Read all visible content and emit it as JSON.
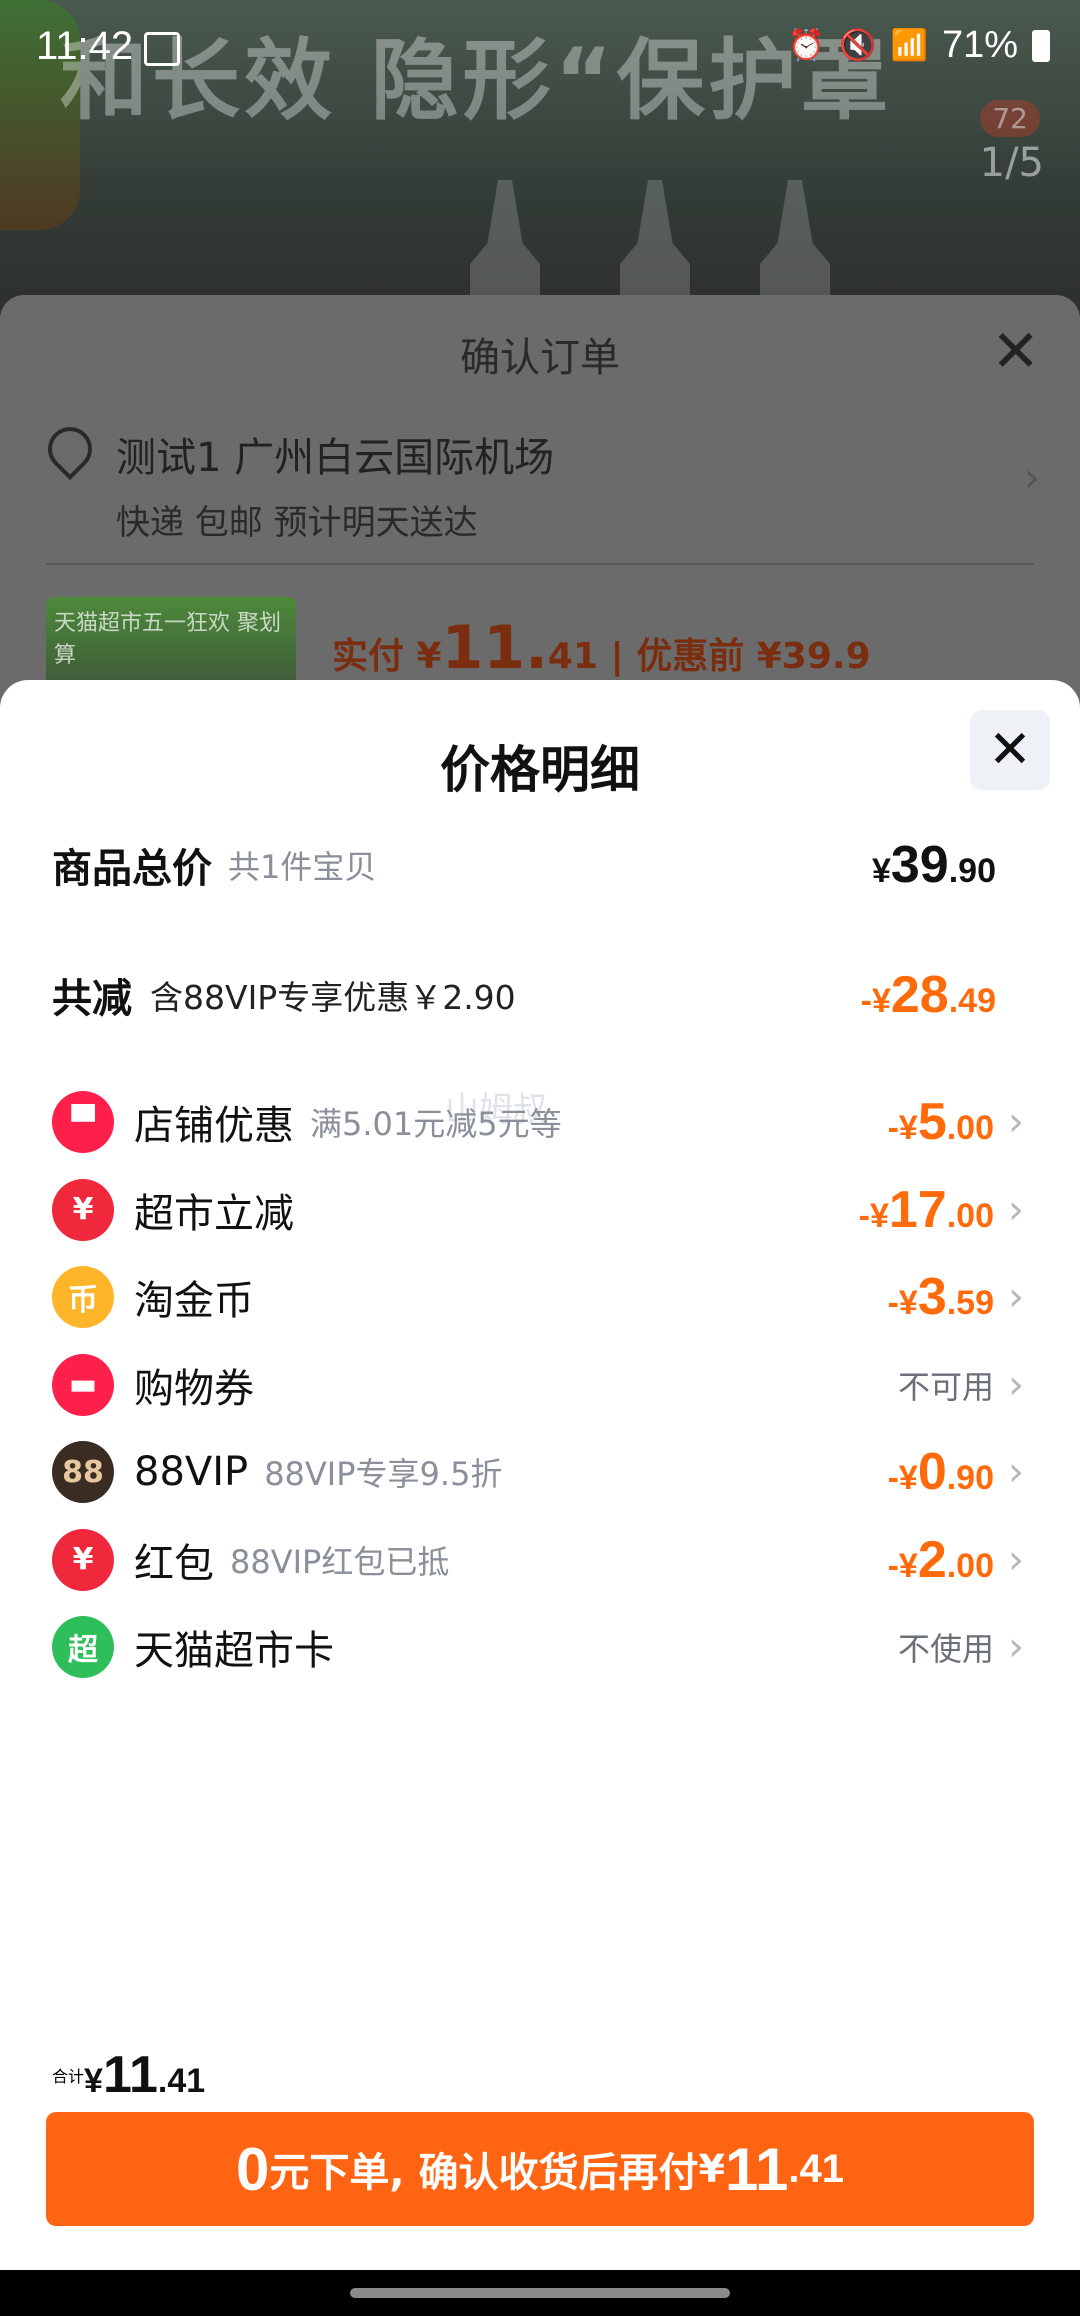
{
  "status_bar": {
    "time": "11:42",
    "battery": "71%"
  },
  "product_bg": {
    "banner_text": "和长效 隐形“保护罩",
    "image_counter": "1/5",
    "badge": "72"
  },
  "order_sheet": {
    "title": "确认订单",
    "address": "测试1 广州白云国际机场",
    "delivery": "快递 包邮 预计明天送达",
    "thumb_text": "天猫超市五一狂欢 聚划算",
    "pay_prefix": "实付 ¥",
    "pay_int": "11.",
    "pay_dec": "41",
    "pay_before": "| 优惠前 ¥39.9"
  },
  "price_sheet": {
    "title": "价格明细",
    "watermark": "山姆叔",
    "goods_total": {
      "label": "商品总价",
      "sub": "共1件宝贝",
      "yen": "¥",
      "int": "39",
      "dec": ".90"
    },
    "discount_total": {
      "label": "共减",
      "sub": "含88VIP专享优惠￥2.90",
      "yen": "-¥",
      "int": "28",
      "dec": ".49"
    },
    "items": [
      {
        "label": "店铺优惠",
        "sub": "满5.01元减5元等",
        "icon": "store-icon",
        "yen": "-¥",
        "int": "5",
        "dec": ".00",
        "status": ""
      },
      {
        "label": "超市立减",
        "sub": "",
        "icon": "supermarket-discount-icon",
        "yen": "-¥",
        "int": "17",
        "dec": ".00",
        "status": ""
      },
      {
        "label": "淘金币",
        "sub": "",
        "icon": "coin-icon",
        "yen": "-¥",
        "int": "3",
        "dec": ".59",
        "status": ""
      },
      {
        "label": "购物券",
        "sub": "",
        "icon": "coupon-icon",
        "yen": "",
        "int": "",
        "dec": "",
        "status": "不可用"
      },
      {
        "label": "88VIP",
        "sub": "88VIP专享9.5折",
        "icon": "88vip-icon",
        "yen": "-¥",
        "int": "0",
        "dec": ".90",
        "status": ""
      },
      {
        "label": "红包",
        "sub": "88VIP红包已抵",
        "icon": "red-packet-icon",
        "yen": "-¥",
        "int": "2",
        "dec": ".00",
        "status": ""
      },
      {
        "label": "天猫超市卡",
        "sub": "",
        "icon": "tmall-card-icon",
        "yen": "",
        "int": "",
        "dec": "",
        "status": "不使用"
      }
    ],
    "total": {
      "label": "合计",
      "yen": "¥",
      "int": "11",
      "dec": ".41"
    },
    "cta": {
      "big": "0",
      "text": "元下单, 确认收货后再付",
      "yen": "¥",
      "int": "11",
      "dec": ".41"
    }
  },
  "colors": {
    "accent": "#ff6412",
    "discount": "#ff6a0a"
  }
}
